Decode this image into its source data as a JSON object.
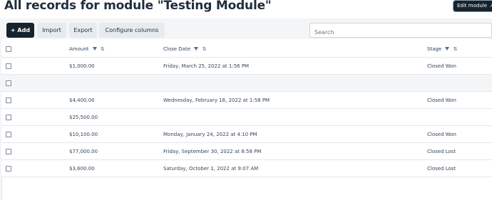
{
  "page": {
    "title": "All records for module \"Testing Module\"",
    "edit_module_label": "Edit module",
    "edit_module_icon": "external-link-icon"
  },
  "toolbar": {
    "add_label": "+ Add",
    "import_label": "Import",
    "export_label": "Export",
    "configure_label": "Configure columns"
  },
  "search": {
    "placeholder": "Search",
    "value": ""
  },
  "table": {
    "columns": [
      {
        "label": "Amount",
        "icons": [
          "filter-icon",
          "sort-icon"
        ]
      },
      {
        "label": "Close Date",
        "icons": [
          "filter-icon",
          "sort-icon"
        ]
      },
      {
        "label": "Stage",
        "icons": [
          "filter-icon",
          "sort-icon"
        ]
      }
    ],
    "rows": [
      {
        "amount": "$1,000.00",
        "close_date": "Friday, March 25, 2022 at 1:56 PM",
        "stage": "Closed Won"
      },
      {
        "amount": "",
        "close_date": "",
        "stage": ""
      },
      {
        "amount": "$4,400.00",
        "close_date": "Wednesday, February 16, 2022 at 1:58 PM",
        "stage": "Closed Won"
      },
      {
        "amount": "$25,500.00",
        "close_date": "",
        "stage": ""
      },
      {
        "amount": "$10,100.00",
        "close_date": "Monday, January 24, 2022 at 4:10 PM",
        "stage": "Closed Won"
      },
      {
        "amount": "$77,000.00",
        "close_date": "Friday, September 30, 2022 at 8:58 PM",
        "stage": "Closed Lost"
      },
      {
        "amount": "$3,600.00",
        "close_date": "Saturday, October 1, 2022 at 9:07 AM",
        "stage": "Closed Lost"
      }
    ]
  },
  "colors": {
    "primary_button": "#15232e",
    "secondary_button": "#e8ebee",
    "band": "#f4f5f7",
    "text": "#33475b"
  }
}
